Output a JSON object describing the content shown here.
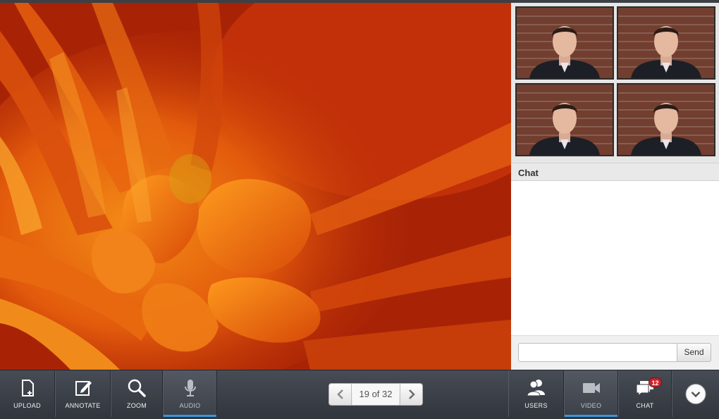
{
  "slide": {
    "name": "orange-flower-slide"
  },
  "video_tiles": [
    {
      "name": "participant-1"
    },
    {
      "name": "participant-2"
    },
    {
      "name": "participant-3"
    },
    {
      "name": "participant-4"
    }
  ],
  "chat": {
    "title": "Chat",
    "input_value": "",
    "input_placeholder": "",
    "send_label": "Send"
  },
  "toolbar": {
    "upload_label": "UPLOAD",
    "annotate_label": "ANNOTATE",
    "zoom_label": "ZOOM",
    "audio_label": "AUDIO",
    "pager_text": "19 of 32",
    "users_label": "USERS",
    "video_label": "VIDEO",
    "chat_label": "CHAT",
    "chat_badge": "12"
  },
  "colors": {
    "accent_blue": "#3d94db",
    "badge_red": "#c4262c",
    "toolbar_dark": "#31353c"
  },
  "icons": [
    "upload-icon",
    "annotate-icon",
    "zoom-icon",
    "microphone-icon",
    "chevron-left-icon",
    "chevron-right-icon",
    "users-icon",
    "video-camera-icon",
    "chat-icon",
    "chevron-down-icon"
  ]
}
